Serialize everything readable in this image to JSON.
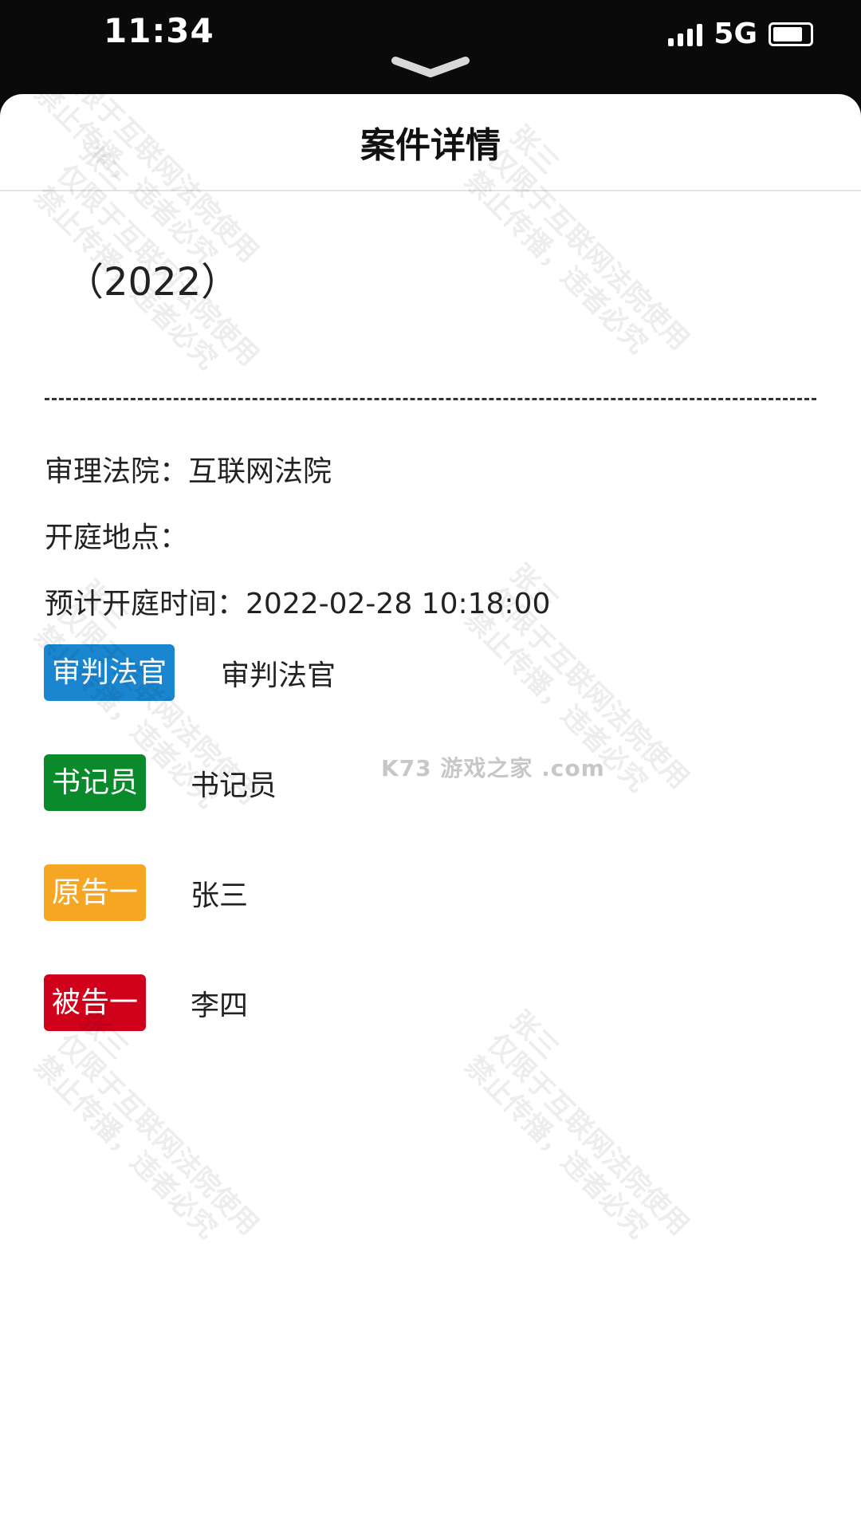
{
  "status_bar": {
    "time": "11:34",
    "network": "5G"
  },
  "sheet": {
    "title": "案件详情"
  },
  "case": {
    "number": "（2022）"
  },
  "info": {
    "court_label": "审理法院：",
    "court_value": "互联网法院",
    "place_label": "开庭地点：",
    "place_value": "",
    "time_label": "预计开庭时间：",
    "time_value": "2022-02-28 10:18:00"
  },
  "parties": [
    {
      "role": "审判法官",
      "name": "审判法官",
      "color": "#1a86d0"
    },
    {
      "role": "书记员",
      "name": "书记员",
      "color": "#0a8a2a"
    },
    {
      "role": "原告一",
      "name": "张三",
      "color": "#f5a623"
    },
    {
      "role": "被告一",
      "name": "李四",
      "color": "#d0021b"
    }
  ],
  "watermark": {
    "line1": "张三",
    "line2": "仅限于互联网法院使用",
    "line3": "禁止传播，违者必究"
  },
  "logo_text": "K73 游戏之家 .com"
}
